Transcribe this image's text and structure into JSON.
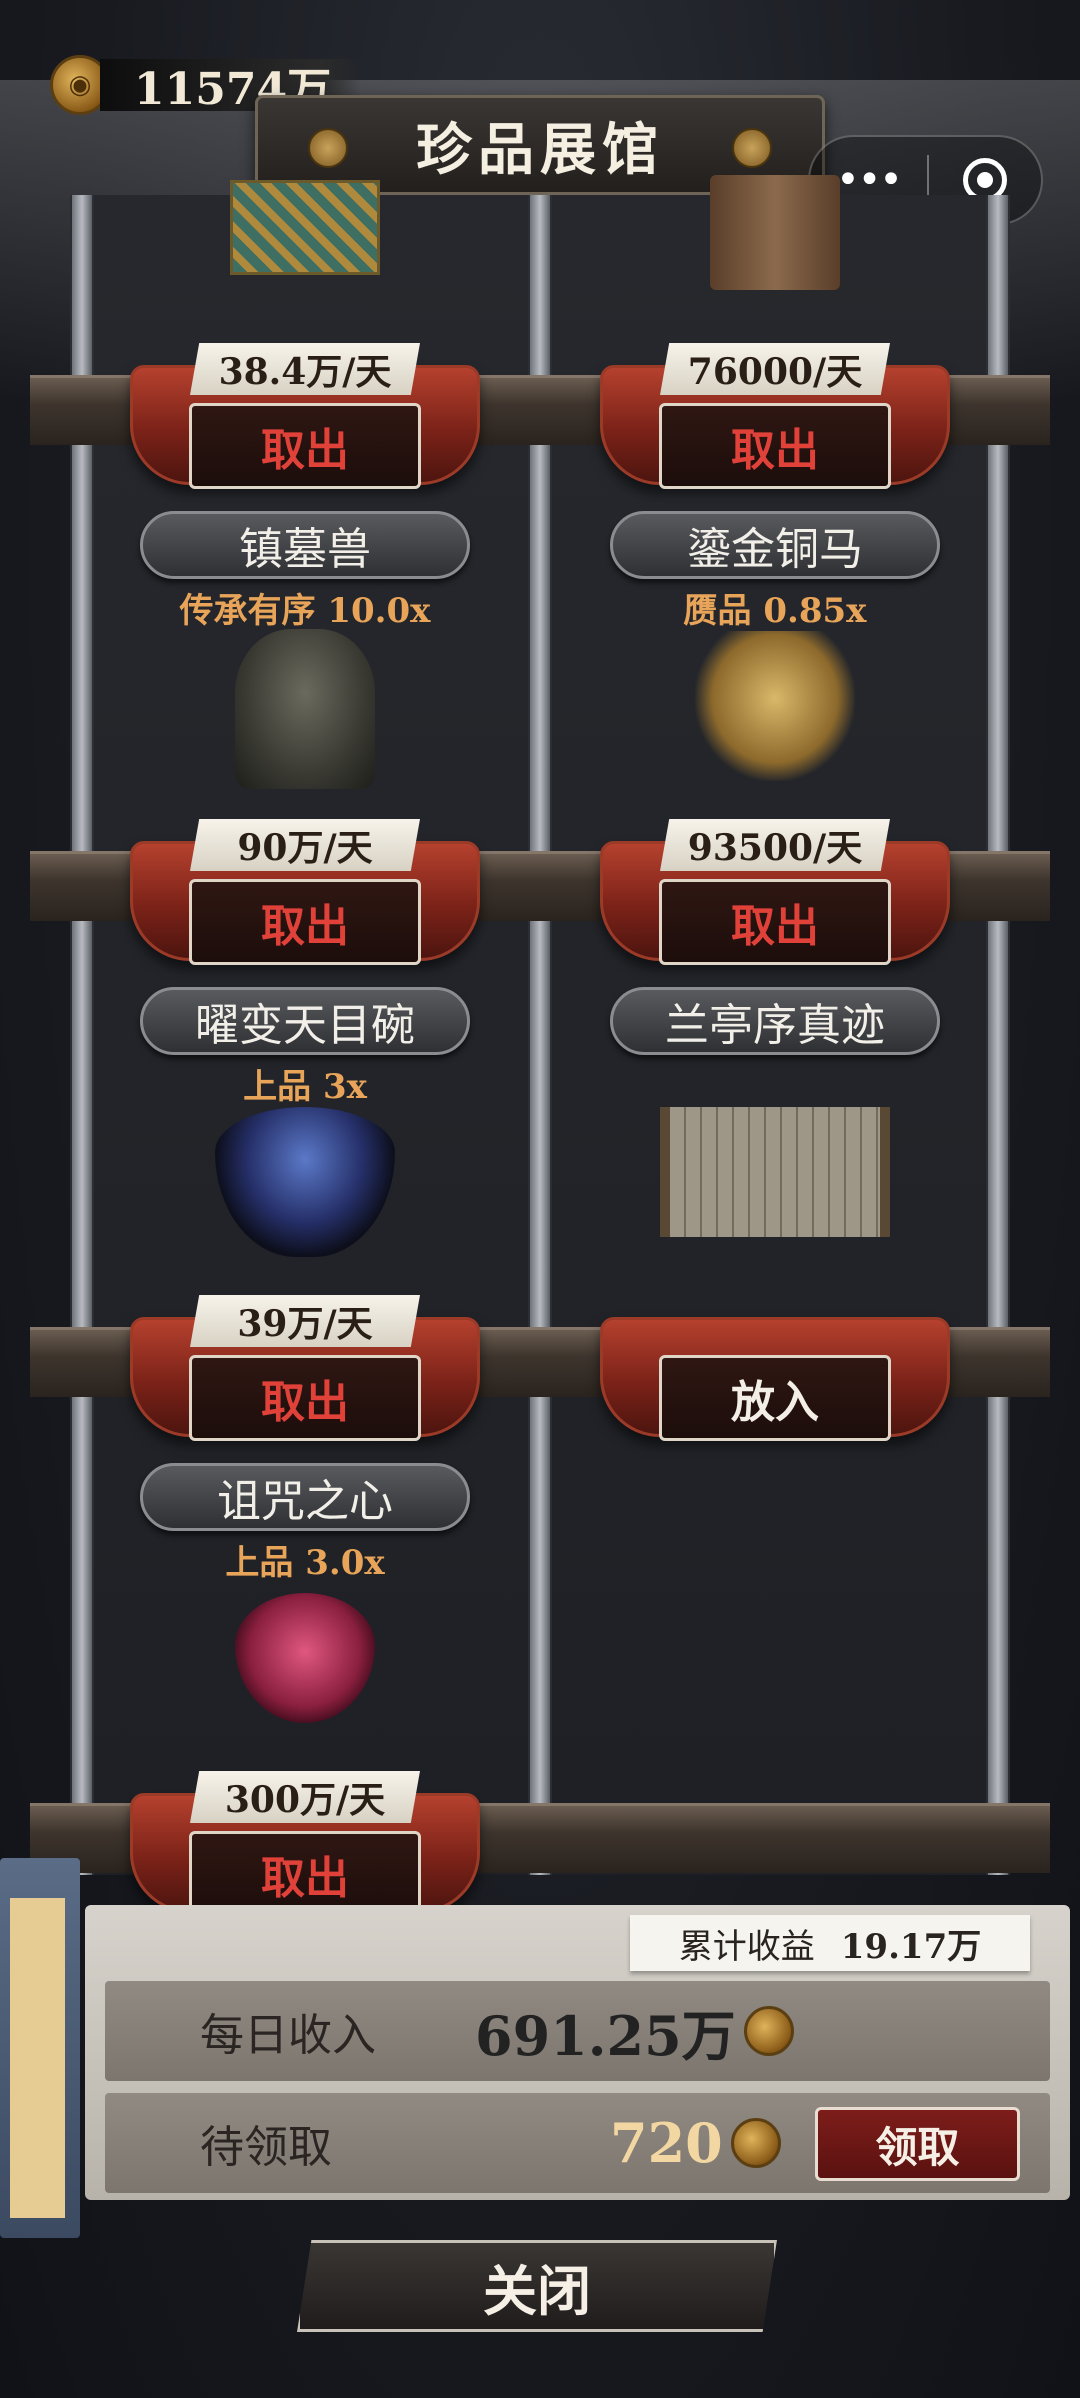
{
  "header": {
    "coin_balance": "11574万",
    "title": "珍品展馆"
  },
  "miniapp_capsule": {
    "more": "•••"
  },
  "cabinet": {
    "cells": [
      {
        "name": "",
        "quality": "",
        "rate": "38.4万/天",
        "action": "取出",
        "art": "dragon-tile"
      },
      {
        "name": "",
        "quality": "",
        "rate": "76000/天",
        "action": "取出",
        "art": "ancient-scroll"
      },
      {
        "name": "镇墓兽",
        "quality": "传承有序 10.0x",
        "rate": "90万/天",
        "action": "取出",
        "art": "tomb-guardian"
      },
      {
        "name": "鎏金铜马",
        "quality": "赝品 0.85x",
        "rate": "93500/天",
        "action": "取出",
        "art": "gilt-bronze-horse"
      },
      {
        "name": "曜变天目碗",
        "quality": "上品 3x",
        "rate": "39万/天",
        "action": "取出",
        "art": "tenmoku-bowl"
      },
      {
        "name": "兰亭序真迹",
        "quality": "",
        "rate": "",
        "action": "放入",
        "art": "calligraphy-scroll"
      },
      {
        "name": "诅咒之心",
        "quality": "上品 3.0x",
        "rate": "300万/天",
        "action": "取出",
        "art": "cursed-heart"
      }
    ]
  },
  "summary": {
    "cumulative_label": "累计收益",
    "cumulative_value": "19.17万",
    "daily_label": "每日收入",
    "daily_value": "691.25万",
    "pending_label": "待领取",
    "pending_value": "720",
    "collect_label": "领取"
  },
  "close_label": "关闭"
}
